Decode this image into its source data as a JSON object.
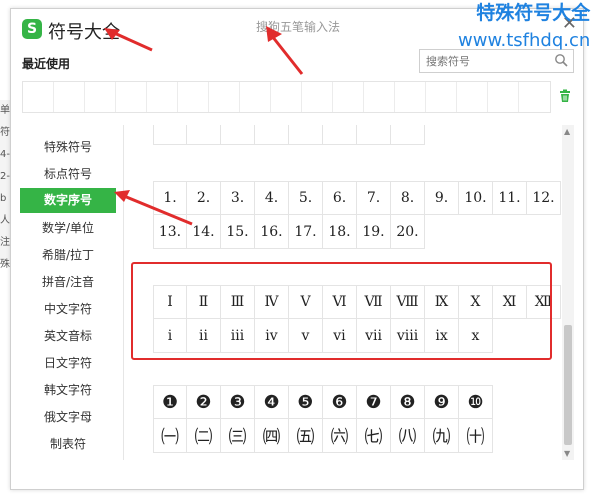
{
  "background": {
    "edge_chars": [
      "单",
      "符",
      "4-",
      "2-",
      "b",
      "人",
      "注",
      "殊"
    ]
  },
  "window": {
    "logo_glyph": "S",
    "title": "符号大全",
    "subtitle": "搜狗五笔输入法",
    "close_glyph": "✕"
  },
  "recent": {
    "label": "最近使用",
    "slot_count": 17
  },
  "search": {
    "placeholder": "搜索符号"
  },
  "sidebar": {
    "items": [
      {
        "label": "特殊符号"
      },
      {
        "label": "标点符号"
      },
      {
        "label": "数字序号",
        "active": true
      },
      {
        "label": "数学/单位"
      },
      {
        "label": "希腊/拉丁"
      },
      {
        "label": "拼音/注音"
      },
      {
        "label": "中文字符"
      },
      {
        "label": "英文音标"
      },
      {
        "label": "日文字符"
      },
      {
        "label": "韩文字符"
      },
      {
        "label": "俄文字母"
      },
      {
        "label": "制表符"
      }
    ]
  },
  "content": {
    "partial_row": [
      "",
      "",
      "",
      "",
      "",
      "",
      "",
      ""
    ],
    "number_rows": [
      [
        "1.",
        "2.",
        "3.",
        "4.",
        "5.",
        "6.",
        "7.",
        "8.",
        "9.",
        "10.",
        "11.",
        "12."
      ],
      [
        "13.",
        "14.",
        "15.",
        "16.",
        "17.",
        "18.",
        "19.",
        "20."
      ]
    ],
    "roman_rows": [
      [
        "Ⅰ",
        "Ⅱ",
        "Ⅲ",
        "Ⅳ",
        "Ⅴ",
        "Ⅵ",
        "Ⅶ",
        "Ⅷ",
        "Ⅸ",
        "Ⅹ",
        "Ⅺ",
        "Ⅻ"
      ],
      [
        "ⅰ",
        "ⅱ",
        "ⅲ",
        "ⅳ",
        "ⅴ",
        "ⅵ",
        "ⅶ",
        "ⅷ",
        "ⅸ",
        "ⅹ"
      ]
    ],
    "circle_rows": [
      [
        "❶",
        "❷",
        "❸",
        "❹",
        "❺",
        "❻",
        "❼",
        "❽",
        "❾",
        "❿"
      ],
      [
        "㈠",
        "㈡",
        "㈢",
        "㈣",
        "㈤",
        "㈥",
        "㈦",
        "㈧",
        "㈨",
        "㈩"
      ]
    ]
  },
  "watermark": {
    "line1": "特殊符号大全",
    "line2": "www.tsfhdq.cn"
  },
  "colors": {
    "accent_green": "#35b446",
    "highlight_red": "#e12c2c",
    "watermark_blue": "#1f82e0"
  }
}
